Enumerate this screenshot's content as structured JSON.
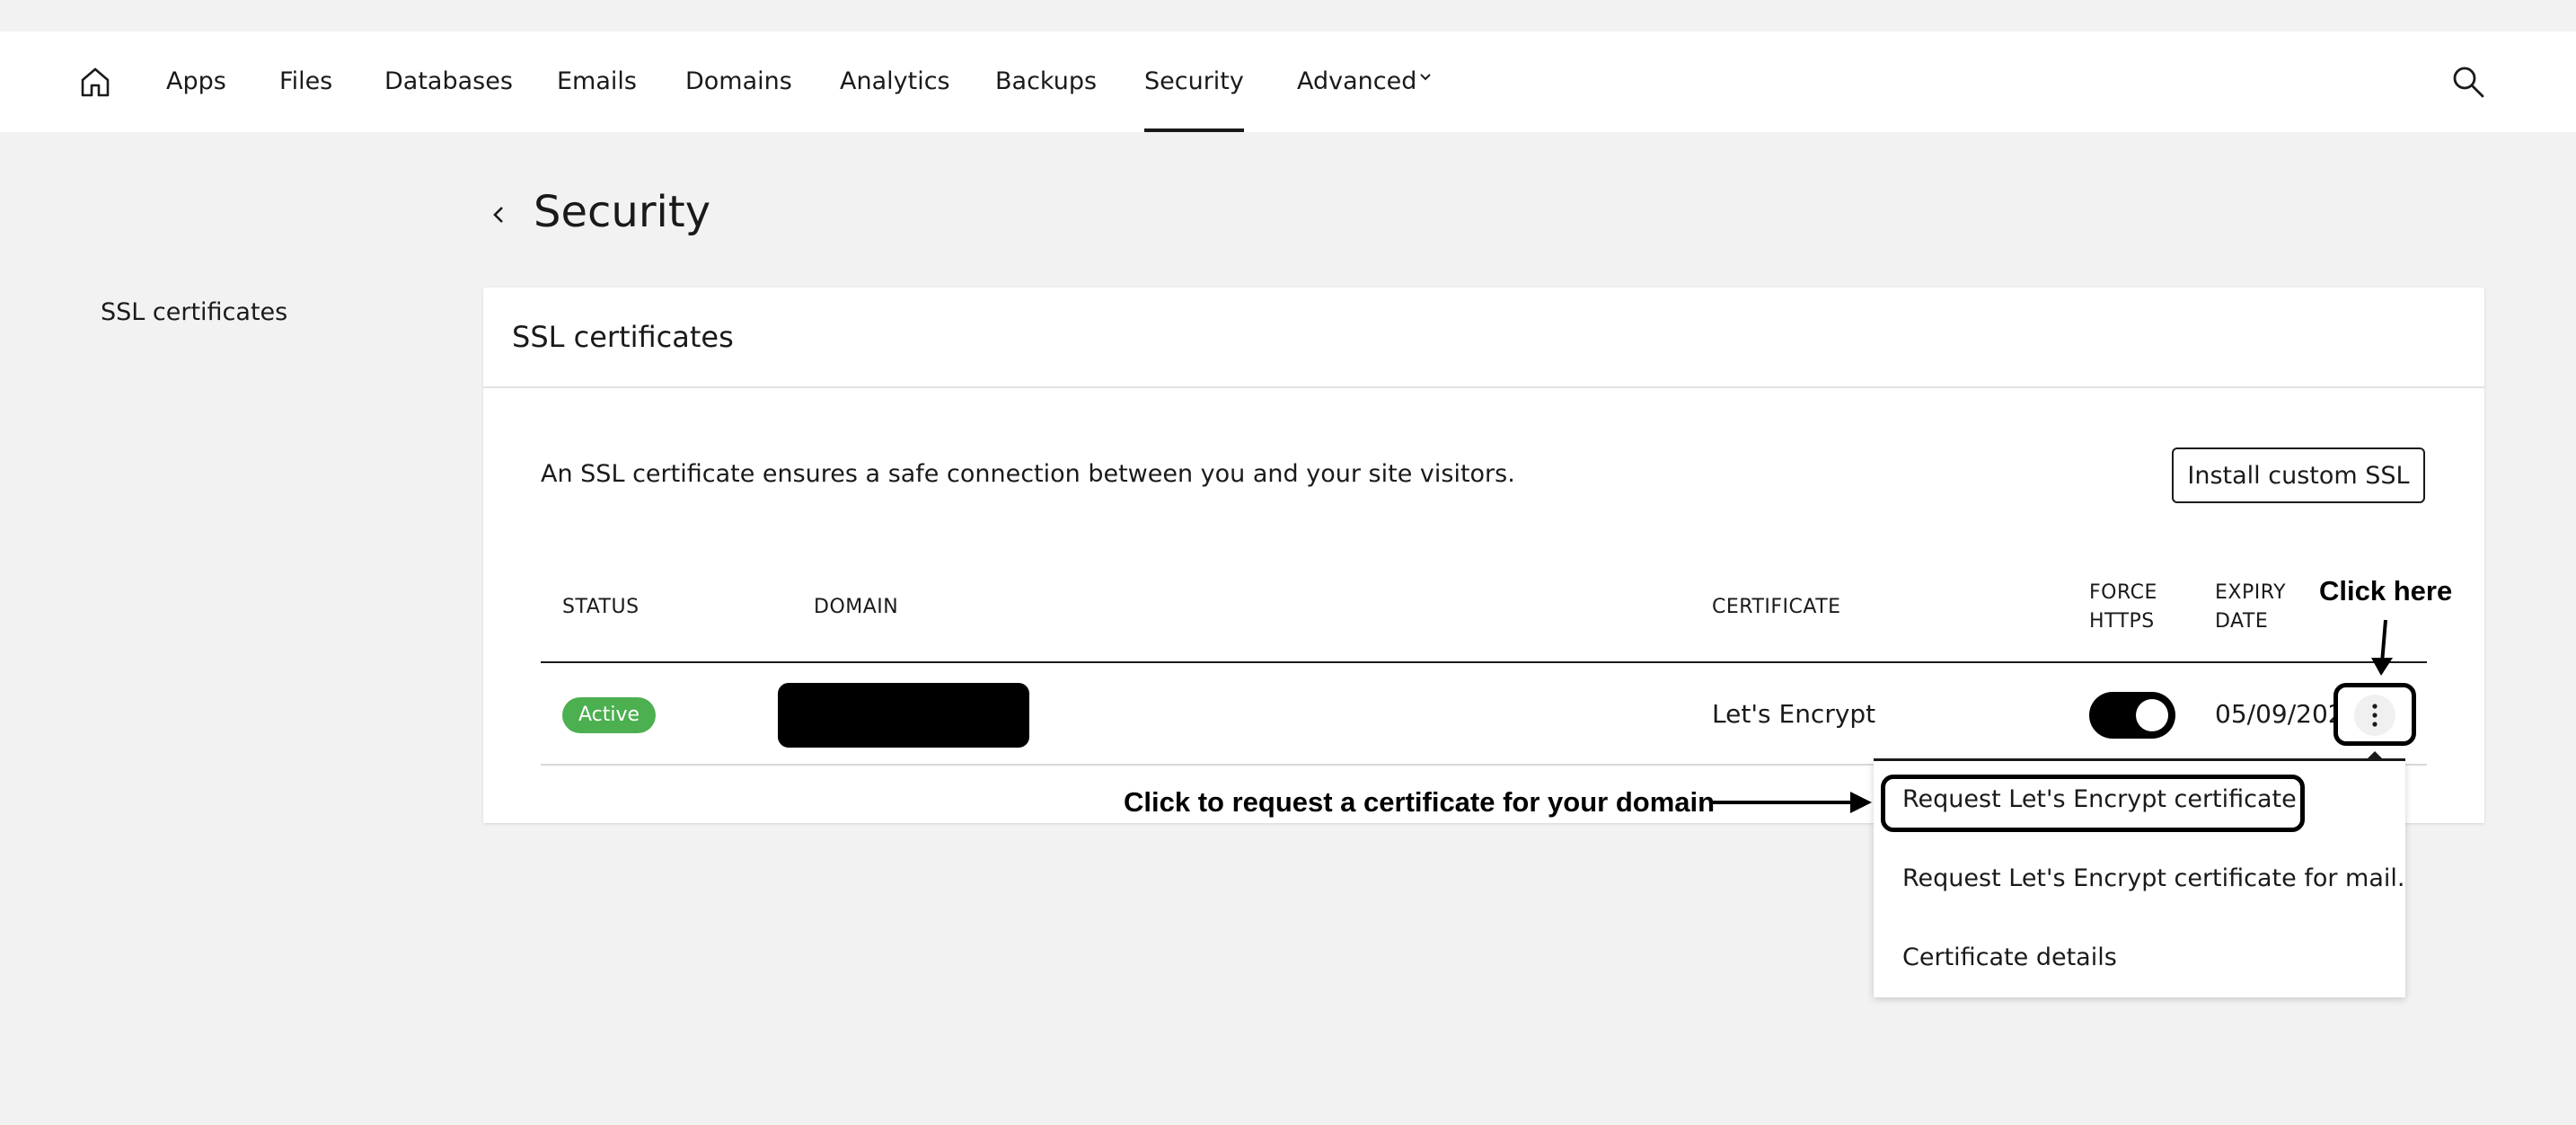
{
  "nav": {
    "items": [
      {
        "label": "Apps"
      },
      {
        "label": "Files"
      },
      {
        "label": "Databases"
      },
      {
        "label": "Emails"
      },
      {
        "label": "Domains"
      },
      {
        "label": "Analytics"
      },
      {
        "label": "Backups"
      },
      {
        "label": "Security",
        "active": true
      },
      {
        "label": "Advanced"
      }
    ],
    "home_icon": "home-icon",
    "search_icon": "search-icon",
    "advanced_chevron_icon": "chevron-down-icon"
  },
  "page": {
    "title": "Security",
    "back_icon": "chevron-left-icon"
  },
  "sidebar": {
    "items": [
      {
        "label": "SSL certificates"
      }
    ]
  },
  "card": {
    "title": "SSL certificates",
    "description": "An SSL certificate ensures a safe connection between you and your site visitors.",
    "install_button": "Install custom SSL",
    "columns": {
      "status": "STATUS",
      "domain": "DOMAIN",
      "certificate": "CERTIFICATE",
      "force_https_1": "FORCE",
      "force_https_2": "HTTPS",
      "expiry_1": "EXPIRY",
      "expiry_2": "DATE"
    },
    "rows": [
      {
        "status": "Active",
        "domain": "",
        "certificate": "Let's Encrypt",
        "force_https": true,
        "expiry": "05/09/2025",
        "menu_icon": "more-vertical-icon"
      }
    ]
  },
  "dropdown": {
    "items": [
      {
        "label": "Request Let's Encrypt certificate"
      },
      {
        "label": "Request Let's Encrypt certificate for mail."
      },
      {
        "label": "Certificate details"
      }
    ]
  },
  "annotations": {
    "click_here": "Click here",
    "request_hint": "Click to request a certificate for your domain"
  },
  "colors": {
    "status_active": "#4caf50",
    "toggle_on": "#000000",
    "page_bg": "#f2f2f2"
  }
}
